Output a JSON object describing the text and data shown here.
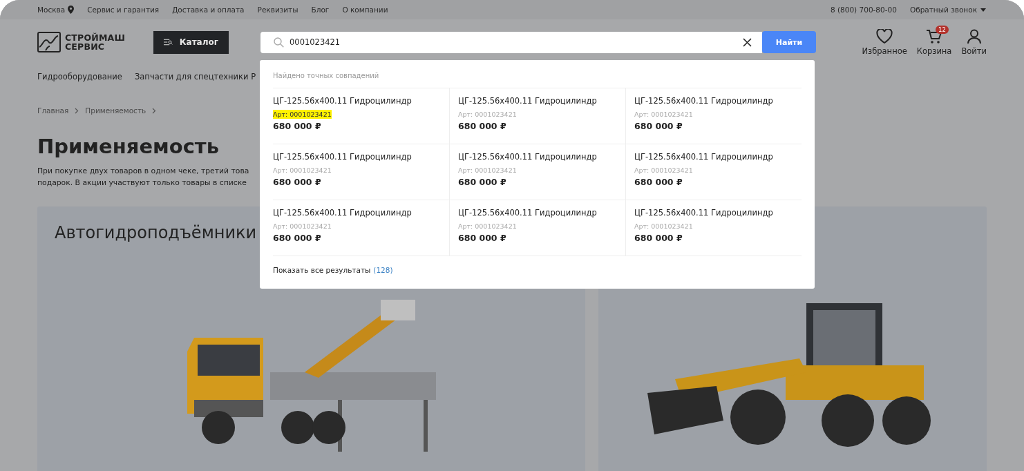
{
  "top_bar": {
    "city": "Москва",
    "links": [
      "Сервис и гарантия",
      "Доставка и оплата",
      "Реквизиты",
      "Блог",
      "О компании"
    ],
    "phone": "8 (800) 700-80-00",
    "callback": "Обратный звонок"
  },
  "header": {
    "logo": [
      "СТРОЙМАШ",
      "СЕРВИС"
    ],
    "catalog_button": "Каталог",
    "search": {
      "value": "0001023421",
      "button": "Найти"
    },
    "actions": [
      {
        "kind": "favorites",
        "label": "Избранное"
      },
      {
        "kind": "cart",
        "label": "Корзина",
        "badge": "12"
      },
      {
        "kind": "account",
        "label": "Войти"
      }
    ]
  },
  "nav": [
    "Гидрооборудование",
    "Запчасти для спецтехники Р"
  ],
  "breadcrumbs": [
    "Главная",
    "Применяемость"
  ],
  "title": "Применяемость",
  "description": [
    "При покупке двух товаров в одном чеке, третий това",
    "подарок. В акции участвуют только товары в списке"
  ],
  "categories": [
    {
      "kind": "lift",
      "title": "Автогидроподъёмники"
    },
    {
      "kind": "grader"
    }
  ],
  "search_results": {
    "heading": "Найдено точных совпадений",
    "items": [
      {
        "name": "ЦГ-125.56х400.11 Гидроцилиндр",
        "article": "Арт: 0001023421",
        "price": "680 000 ₽",
        "highlighted": true
      },
      {
        "name": "ЦГ-125.56х400.11 Гидроцилиндр",
        "article": "Арт: 0001023421",
        "price": "680 000 ₽",
        "highlighted": false
      },
      {
        "name": "ЦГ-125.56х400.11 Гидроцилиндр",
        "article": "Арт: 0001023421",
        "price": "680 000 ₽",
        "highlighted": false
      },
      {
        "name": "ЦГ-125.56х400.11 Гидроцилиндр",
        "article": "Арт: 0001023421",
        "price": "680 000 ₽",
        "highlighted": false
      },
      {
        "name": "ЦГ-125.56х400.11 Гидроцилиндр",
        "article": "Арт: 0001023421",
        "price": "680 000 ₽",
        "highlighted": false
      },
      {
        "name": "ЦГ-125.56х400.11 Гидроцилиндр",
        "article": "Арт: 0001023421",
        "price": "680 000 ₽",
        "highlighted": false
      },
      {
        "name": "ЦГ-125.56х400.11 Гидроцилиндр",
        "article": "Арт: 0001023421",
        "price": "680 000 ₽",
        "highlighted": false
      },
      {
        "name": "ЦГ-125.56х400.11 Гидроцилиндр",
        "article": "Арт: 0001023421",
        "price": "680 000 ₽",
        "highlighted": false
      },
      {
        "name": "ЦГ-125.56х400.11 Гидроцилиндр",
        "article": "Арт: 0001023421",
        "price": "680 000 ₽",
        "highlighted": false
      }
    ],
    "show_all": "Показать все результаты",
    "count": "(128)"
  }
}
